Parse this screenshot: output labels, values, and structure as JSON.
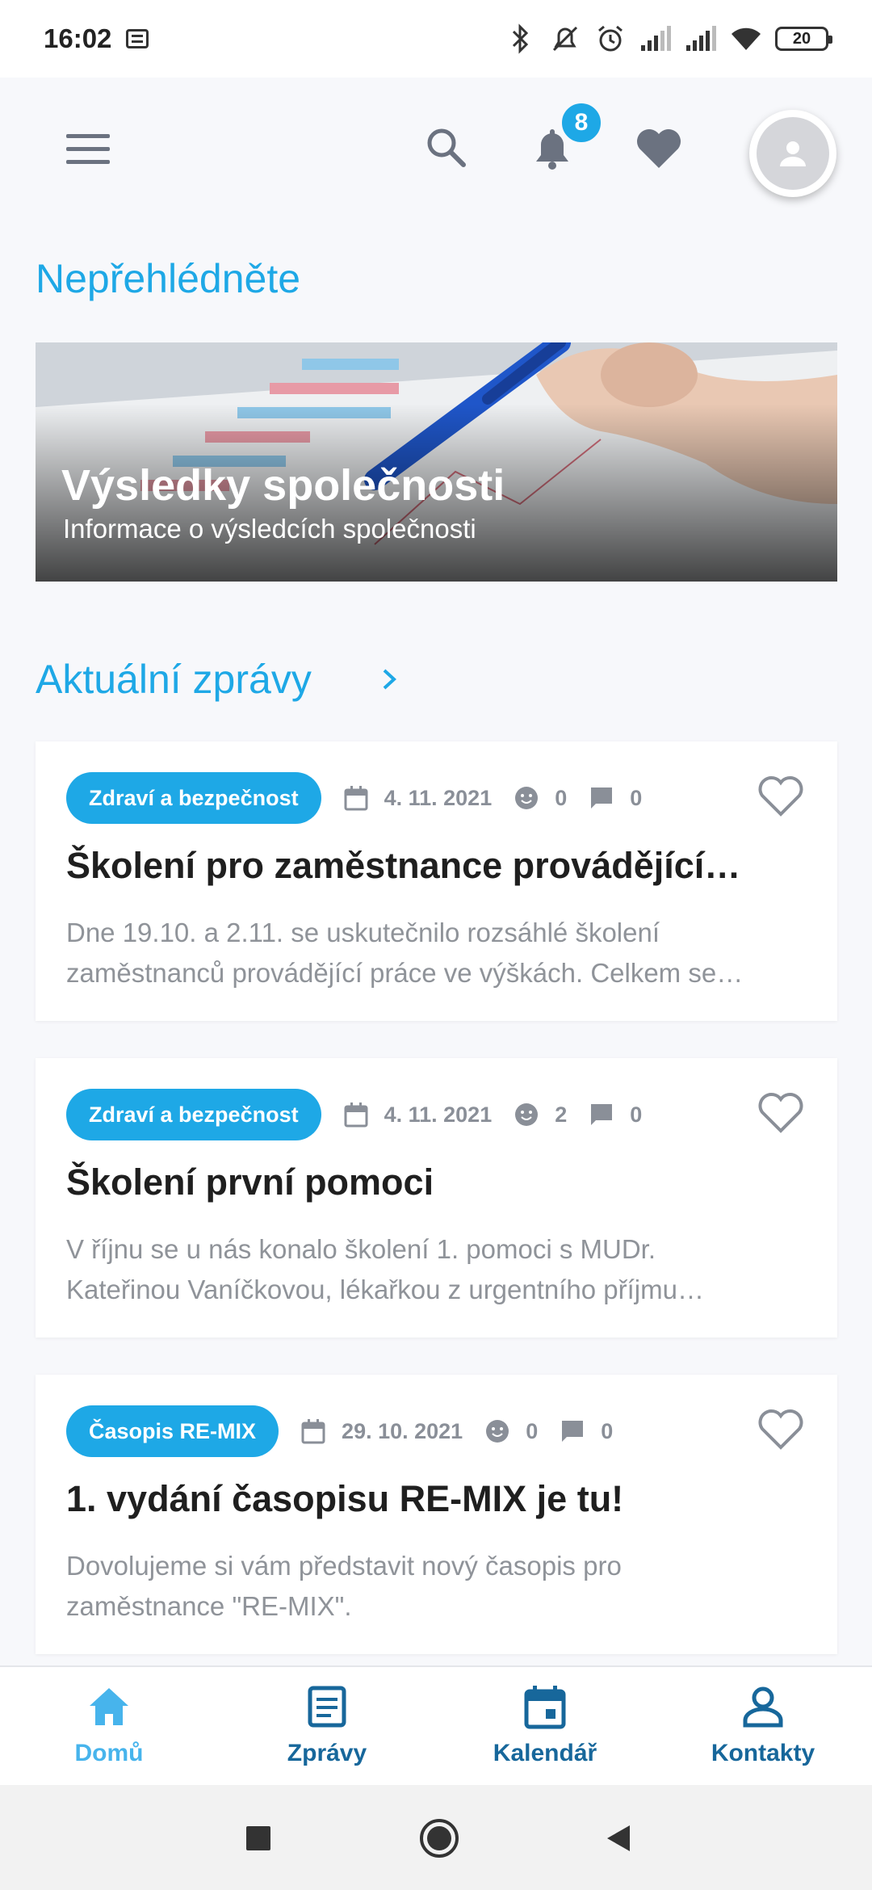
{
  "status_bar": {
    "time": "16:02",
    "battery": "20"
  },
  "header": {
    "notification_count": "8"
  },
  "featured": {
    "title": "Nepřehlédněte",
    "banner": {
      "title": "Výsledky společnosti",
      "subtitle": "Informace o výsledcích společnosti"
    }
  },
  "news": {
    "title": "Aktuální zprávy",
    "items": [
      {
        "category": "Zdraví a bezpečnost",
        "date": "4. 11. 2021",
        "reactions": "0",
        "comments": "0",
        "title": "Školení pro zaměstnance provádějící…",
        "excerpt_1": "Dne 19.10. a 2.11. se uskutečnilo rozsáhlé školení",
        "excerpt_2": "zaměstnanců provádějící práce ve výškách. Celkem se…"
      },
      {
        "category": "Zdraví a bezpečnost",
        "date": "4. 11. 2021",
        "reactions": "2",
        "comments": "0",
        "title": "Školení první pomoci",
        "excerpt_1": "V říjnu se u nás konalo školení 1. pomoci s MUDr.",
        "excerpt_2": "Kateřinou Vaníčkovou, lékařkou z urgentního příjmu…"
      },
      {
        "category": "Časopis RE-MIX",
        "date": "29. 10. 2021",
        "reactions": "0",
        "comments": "0",
        "title": "1. vydání časopisu RE-MIX je tu!",
        "excerpt_1": "Dovolujeme si vám představit nový časopis pro",
        "excerpt_2": "zaměstnance \"RE-MIX\"."
      }
    ]
  },
  "bottom_nav": [
    {
      "label": "Domů",
      "icon": "home-icon",
      "active": true
    },
    {
      "label": "Zprávy",
      "icon": "article-icon",
      "active": false
    },
    {
      "label": "Kalendář",
      "icon": "calendar-icon",
      "active": false
    },
    {
      "label": "Kontakty",
      "icon": "person-icon",
      "active": false
    }
  ],
  "colors": {
    "accent": "#1ea8e6",
    "nav_active": "#47b4ec",
    "nav_inactive": "#17679b"
  }
}
